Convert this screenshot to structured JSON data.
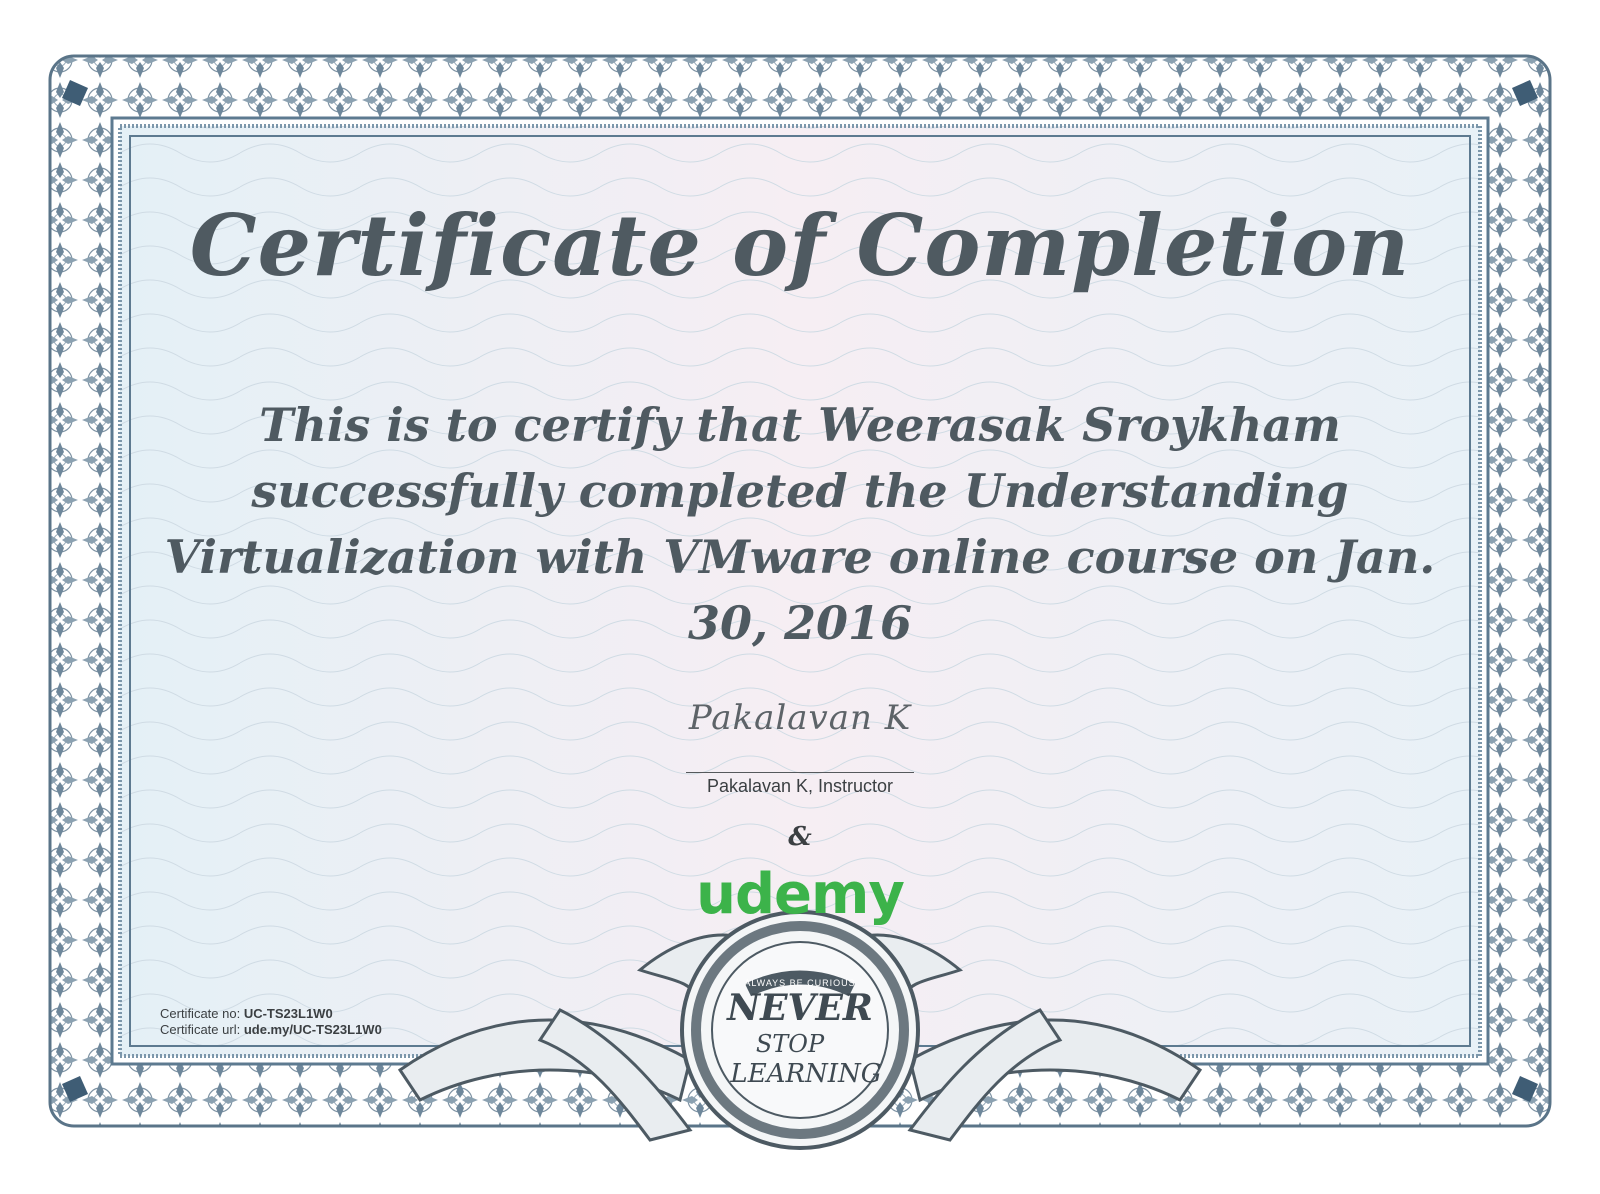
{
  "certificate": {
    "title": "Certificate of Completion",
    "body_lines": [
      "This is to certify that Weerasak Sroykham",
      "successfully completed the Understanding",
      "Virtualization with VMware online course on Jan.",
      "30, 2016"
    ],
    "signature_script": "Pakalavan K",
    "signature_caption": "Pakalavan K, Instructor",
    "ampersand": "&",
    "logo_text": "udemy",
    "certificate_no_label": "Certificate no:",
    "certificate_no": "UC-TS23L1W0",
    "certificate_url_label": "Certificate url:",
    "certificate_url": "ude.my/UC-TS23L1W0",
    "seal": {
      "top_text": "ALWAYS BE CURIOUS",
      "line1": "NEVER",
      "line2": "STOP",
      "line3": "LEARNING"
    }
  },
  "colors": {
    "text": "#4f5a61",
    "frame": "#55738c",
    "logo": "#3cb34a",
    "panel_left": "#e6f1f6",
    "panel_mid": "#f5eef3",
    "panel_right": "#e9f1f6"
  }
}
